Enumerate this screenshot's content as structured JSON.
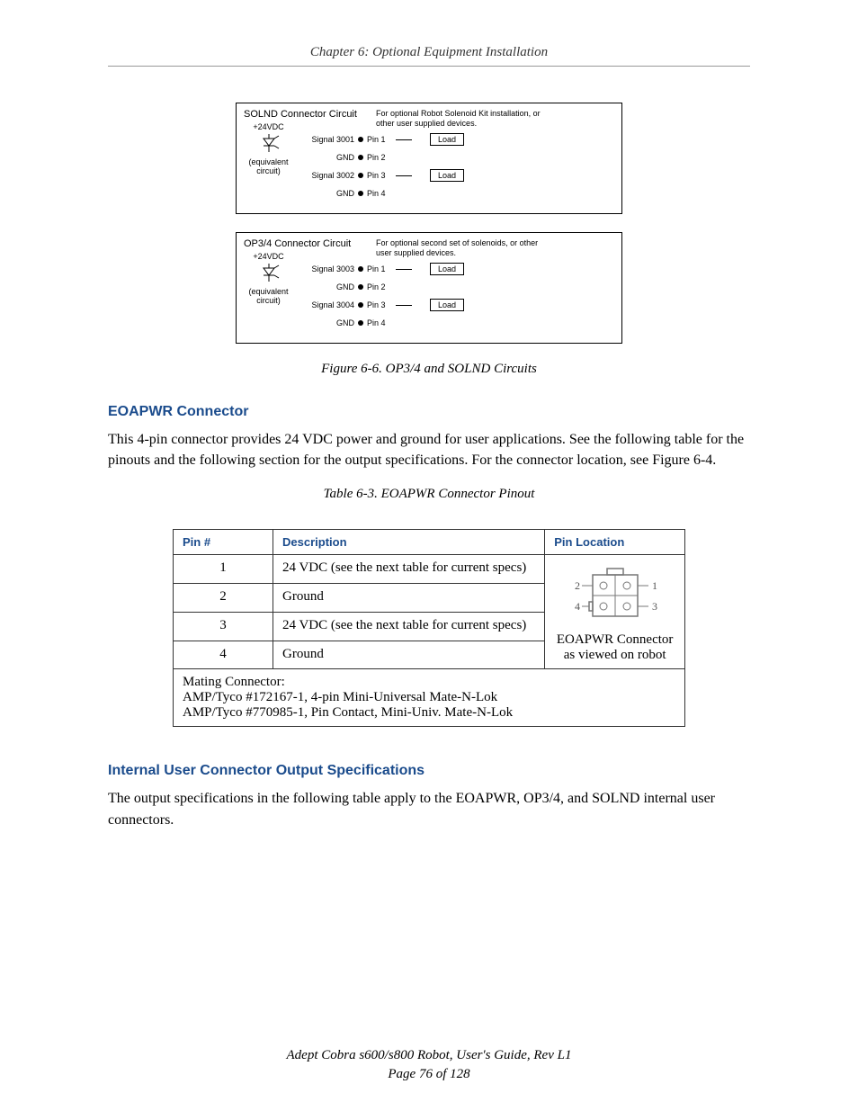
{
  "header": {
    "chapter": "Chapter 6: Optional Equipment Installation"
  },
  "diagram": {
    "circuits": [
      {
        "title": "SOLND Connector Circuit",
        "voltage": "+24VDC",
        "eq_label": "(equivalent circuit)",
        "note": "For optional Robot Solenoid Kit installation, or other user supplied devices.",
        "rows": [
          {
            "signal": "Signal 3001",
            "pin": "Pin 1",
            "load": "Load"
          },
          {
            "signal": "GND",
            "pin": "Pin 2",
            "load": null
          },
          {
            "signal": "Signal 3002",
            "pin": "Pin 3",
            "load": "Load"
          },
          {
            "signal": "GND",
            "pin": "Pin 4",
            "load": null
          }
        ]
      },
      {
        "title": "OP3/4 Connector Circuit",
        "voltage": "+24VDC",
        "eq_label": "(equivalent circuit)",
        "note": "For optional second set of solenoids, or other user supplied devices.",
        "rows": [
          {
            "signal": "Signal 3003",
            "pin": "Pin 1",
            "load": "Load"
          },
          {
            "signal": "GND",
            "pin": "Pin 2",
            "load": null
          },
          {
            "signal": "Signal 3004",
            "pin": "Pin 3",
            "load": "Load"
          },
          {
            "signal": "GND",
            "pin": "Pin 4",
            "load": null
          }
        ]
      }
    ],
    "caption": "Figure 6-6. OP3/4 and SOLND Circuits"
  },
  "section1": {
    "heading": "EOAPWR Connector",
    "para": "This 4-pin connector provides 24 VDC power and ground for user applications. See the following table for the pinouts and the following section for the output specifications. For the connector location, see Figure 6-4."
  },
  "table": {
    "caption": "Table 6-3. EOAPWR Connector Pinout",
    "headers": {
      "pin": "Pin #",
      "desc": "Description",
      "loc": "Pin Location"
    },
    "rows": [
      {
        "pin": "1",
        "desc": "24 VDC (see the next table for current specs)"
      },
      {
        "pin": "2",
        "desc": "Ground"
      },
      {
        "pin": "3",
        "desc": "24 VDC (see the next table for current specs)"
      },
      {
        "pin": "4",
        "desc": "Ground"
      }
    ],
    "loc_labels": {
      "p1": "1",
      "p2": "2",
      "p3": "3",
      "p4": "4"
    },
    "loc_caption1": "EOAPWR Connector",
    "loc_caption2": "as viewed on robot",
    "mating": {
      "line1": "Mating Connector:",
      "line2": "AMP/Tyco #172167-1, 4-pin Mini-Universal Mate-N-Lok",
      "line3": "AMP/Tyco #770985-1, Pin Contact, Mini-Univ. Mate-N-Lok"
    }
  },
  "section2": {
    "heading": "Internal User Connector Output Specifications",
    "para": "The output specifications in the following table apply to the EOAPWR, OP3/4, and SOLND internal user connectors."
  },
  "footer": {
    "title": "Adept Cobra s600/s800 Robot, User's Guide, Rev L1",
    "page": "Page 76 of 128"
  }
}
